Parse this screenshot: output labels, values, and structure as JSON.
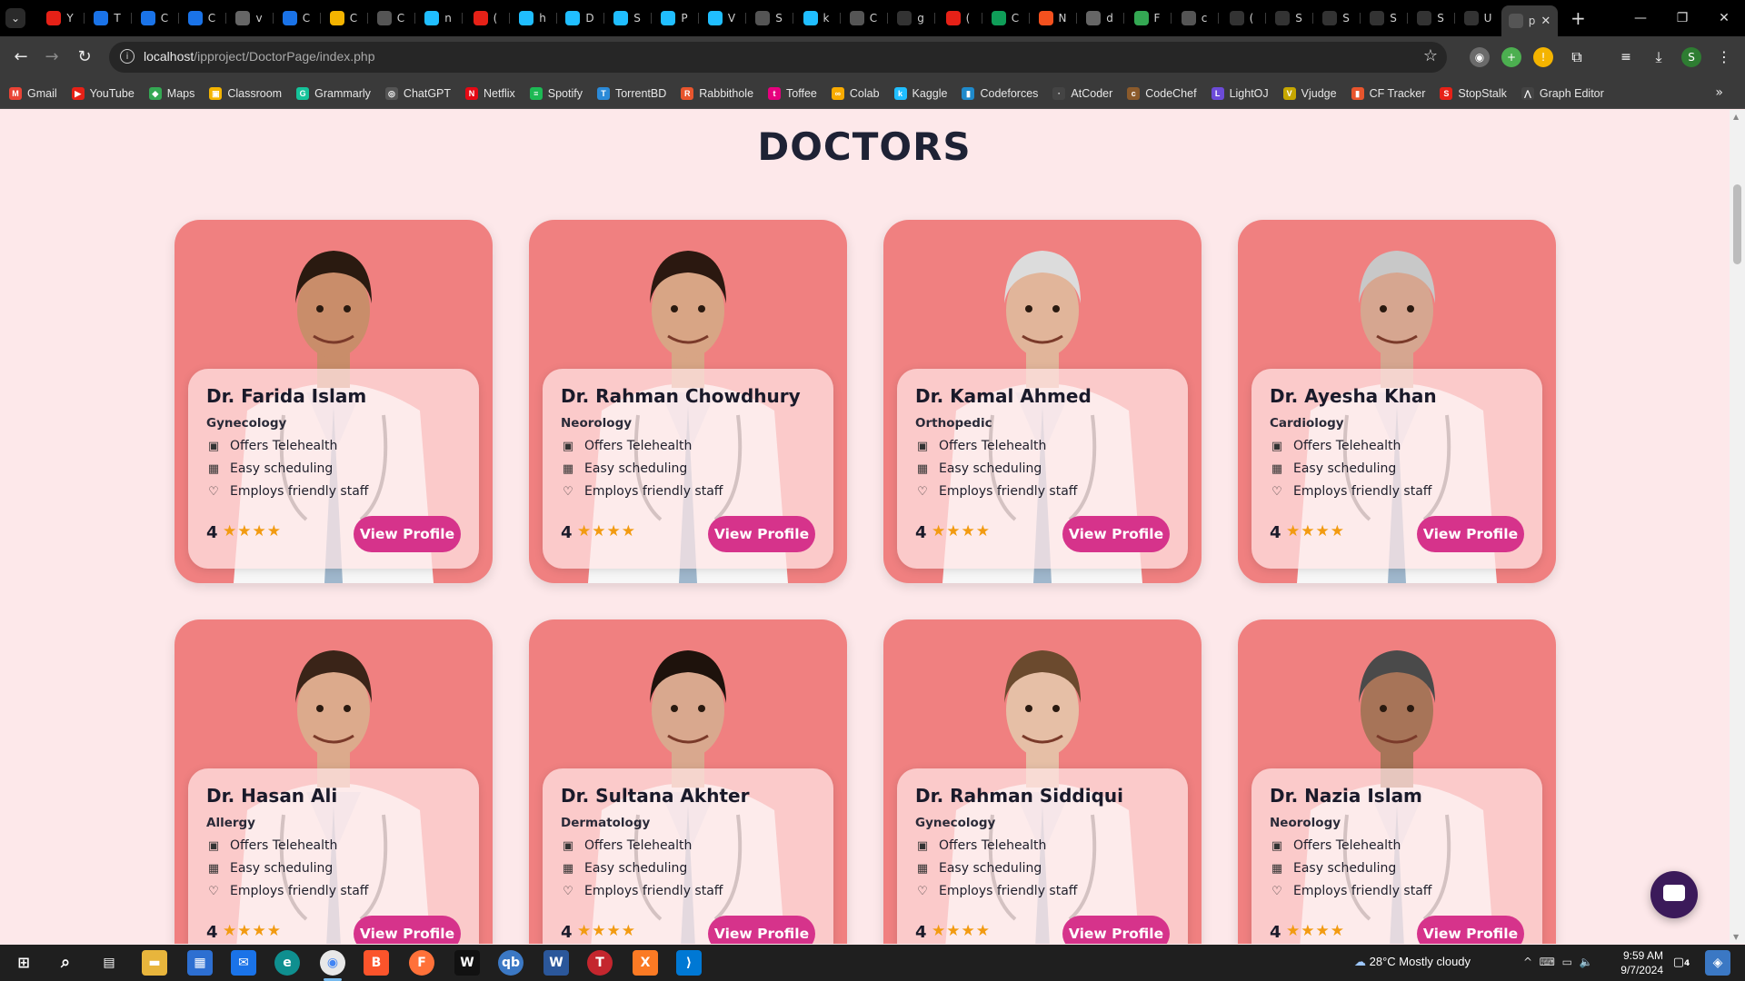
{
  "browser": {
    "tabs": [
      {
        "letter": "Y",
        "color": "#e62117"
      },
      {
        "letter": "T",
        "color": "#1a73e8"
      },
      {
        "letter": "C",
        "color": "#1a73e8"
      },
      {
        "letter": "C",
        "color": "#1a73e8"
      },
      {
        "letter": "v",
        "color": "#666666"
      },
      {
        "letter": "C",
        "color": "#1a73e8"
      },
      {
        "letter": "C",
        "color": "#f4b400"
      },
      {
        "letter": "C",
        "color": "#555555"
      },
      {
        "letter": "n",
        "color": "#20beff"
      },
      {
        "letter": "(",
        "color": "#e62117"
      },
      {
        "letter": "h",
        "color": "#20beff"
      },
      {
        "letter": "D",
        "color": "#20beff"
      },
      {
        "letter": "S",
        "color": "#20beff"
      },
      {
        "letter": "P",
        "color": "#20beff"
      },
      {
        "letter": "V",
        "color": "#20beff"
      },
      {
        "letter": "S",
        "color": "#555555"
      },
      {
        "letter": "k",
        "color": "#20beff"
      },
      {
        "letter": "C",
        "color": "#555555"
      },
      {
        "letter": "g",
        "color": "#333333"
      },
      {
        "letter": "(",
        "color": "#e62117"
      },
      {
        "letter": "C",
        "color": "#0f9d58"
      },
      {
        "letter": "N",
        "color": "#f4511e"
      },
      {
        "letter": "d",
        "color": "#666666"
      },
      {
        "letter": "F",
        "color": "#34a853"
      },
      {
        "letter": "c",
        "color": "#555555"
      },
      {
        "letter": "(",
        "color": "#333333"
      },
      {
        "letter": "S",
        "color": "#333333"
      },
      {
        "letter": "S",
        "color": "#333333"
      },
      {
        "letter": "S",
        "color": "#333333"
      },
      {
        "letter": "S",
        "color": "#333333"
      },
      {
        "letter": "U",
        "color": "#333333"
      }
    ],
    "active_tab": {
      "letter": "p"
    },
    "new_tab": "+",
    "url_host": "localhost",
    "url_path": "/ipproject/DoctorPage/index.php"
  },
  "bookmarks": [
    {
      "label": "Gmail",
      "color": "#ea4335",
      "icon": "M"
    },
    {
      "label": "YouTube",
      "color": "#e62117",
      "icon": "▶"
    },
    {
      "label": "Maps",
      "color": "#34a853",
      "icon": "◆"
    },
    {
      "label": "Classroom",
      "color": "#f4b400",
      "icon": "▣"
    },
    {
      "label": "Grammarly",
      "color": "#15c39a",
      "icon": "G"
    },
    {
      "label": "ChatGPT",
      "color": "#555555",
      "icon": "◎"
    },
    {
      "label": "Netflix",
      "color": "#e50914",
      "icon": "N"
    },
    {
      "label": "Spotify",
      "color": "#1db954",
      "icon": "≡"
    },
    {
      "label": "TorrentBD",
      "color": "#2b8ad8",
      "icon": "T"
    },
    {
      "label": "Rabbithole",
      "color": "#e8552d",
      "icon": "R"
    },
    {
      "label": "Toffee",
      "color": "#e6007e",
      "icon": "t"
    },
    {
      "label": "Colab",
      "color": "#f9ab00",
      "icon": "∞"
    },
    {
      "label": "Kaggle",
      "color": "#20beff",
      "icon": "k"
    },
    {
      "label": "Codeforces",
      "color": "#1f8acb",
      "icon": "▮"
    },
    {
      "label": "AtCoder",
      "color": "#444444",
      "icon": "·"
    },
    {
      "label": "CodeChef",
      "color": "#8b5a2b",
      "icon": "c"
    },
    {
      "label": "LightOJ",
      "color": "#6c4bd8",
      "icon": "L"
    },
    {
      "label": "Vjudge",
      "color": "#c6a700",
      "icon": "V"
    },
    {
      "label": "CF Tracker",
      "color": "#e8552d",
      "icon": "▮"
    },
    {
      "label": "StopStalk",
      "color": "#e62117",
      "icon": "S"
    },
    {
      "label": "Graph Editor",
      "color": "#444444",
      "icon": "⋀"
    }
  ],
  "page": {
    "title": "DOCTORS",
    "button_label": "View Profile",
    "features": [
      "Offers Telehealth",
      "Easy scheduling",
      "Employs friendly staff"
    ],
    "doctors": [
      {
        "name": "Dr. Farida Islam",
        "specialty": "Gynecology",
        "rating": "4",
        "stars": "★★★★",
        "skin": "#c98d6a",
        "hair": "#2a1a10"
      },
      {
        "name": "Dr. Rahman Chowdhury",
        "specialty": "Neorology",
        "rating": "4",
        "stars": "★★★★",
        "skin": "#d8a585",
        "hair": "#2b1810"
      },
      {
        "name": "Dr. Kamal Ahmed",
        "specialty": "Orthopedic",
        "rating": "4",
        "stars": "★★★★",
        "skin": "#e1b59a",
        "hair": "#dcdcdc"
      },
      {
        "name": "Dr. Ayesha Khan",
        "specialty": "Cardiology",
        "rating": "4",
        "stars": "★★★★",
        "skin": "#d6a690",
        "hair": "#c8c8c8"
      },
      {
        "name": "Dr. Hasan Ali",
        "specialty": "Allergy",
        "rating": "4",
        "stars": "★★★★",
        "skin": "#dcaa8c",
        "hair": "#3a2418"
      },
      {
        "name": "Dr. Sultana Akhter",
        "specialty": "Dermatology",
        "rating": "4",
        "stars": "★★★★",
        "skin": "#d9a88e",
        "hair": "#1e120c"
      },
      {
        "name": "Dr. Rahman Siddiqui",
        "specialty": "Gynecology",
        "rating": "4",
        "stars": "★★★★",
        "skin": "#e6bfa6",
        "hair": "#6b4a2e"
      },
      {
        "name": "Dr. Nazia Islam",
        "specialty": "Neorology",
        "rating": "4",
        "stars": "★★★★",
        "skin": "#a77458",
        "hair": "#4a4a4a"
      }
    ]
  },
  "taskbar": {
    "weather": "28°C  Mostly cloudy",
    "time": "9:59 AM",
    "date": "9/7/2024",
    "notifications": "4"
  }
}
